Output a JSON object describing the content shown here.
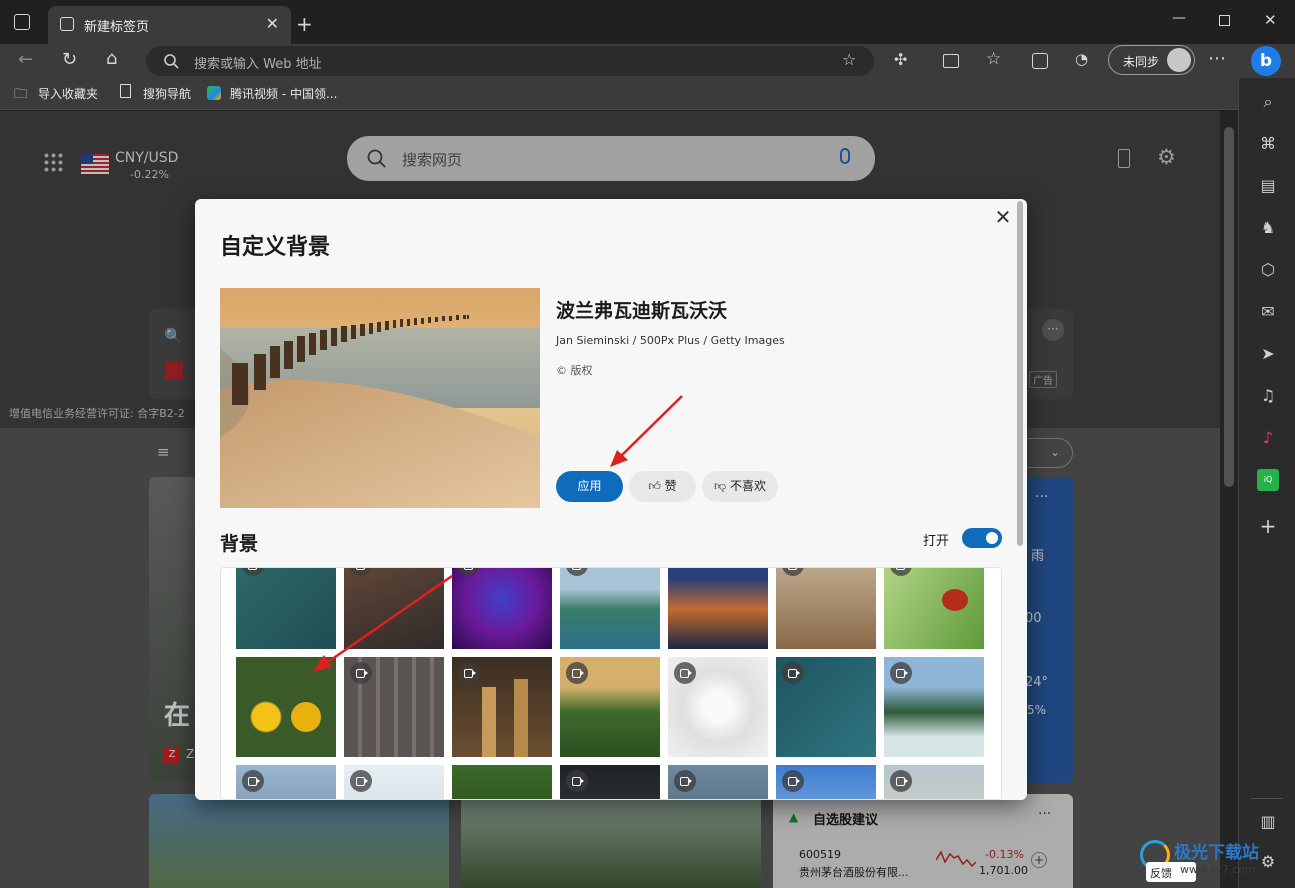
{
  "browser": {
    "tab_title": "新建标签页",
    "address_placeholder": "搜索或输入 Web 地址",
    "sync_label": "未同步",
    "bookmarks": [
      "导入收藏夹",
      "搜狗导航",
      "腾讯视频 - 中国领..."
    ]
  },
  "newtab": {
    "currency_pair": "CNY/USD",
    "currency_change": "-0.22%",
    "search_placeholder": "搜索网页",
    "license_text": "增值电信业务经营许可证: 合字B2-2",
    "ad_label": "广告",
    "stock_card_title": "自选股建议",
    "stock_code": "600519",
    "stock_name": "贵州茅台酒股份有限...",
    "stock_change": "-0.13%",
    "stock_price": "1,701.00",
    "feedback_label": "反馈",
    "weather_fragments": [
      "雨",
      "00",
      "24°",
      "5%"
    ],
    "news_fragment": "在",
    "menu_fragment": "Z"
  },
  "dialog": {
    "title": "自定义背景",
    "image_name": "波兰弗瓦迪斯瓦沃沃",
    "image_credit": "Jan Sieminski / 500Px Plus / Getty Images",
    "copyright": "© 版权",
    "apply_label": "应用",
    "like_label": "赞",
    "dislike_label": "不喜欢",
    "backgrounds_heading": "背景",
    "toggle_label": "打开",
    "toggle_on": true
  },
  "watermark": {
    "brand": "极光下载站",
    "site": "www.xz7.com"
  },
  "colors": {
    "accent": "#0f6cbd",
    "stock_down": "#c42b1c"
  }
}
